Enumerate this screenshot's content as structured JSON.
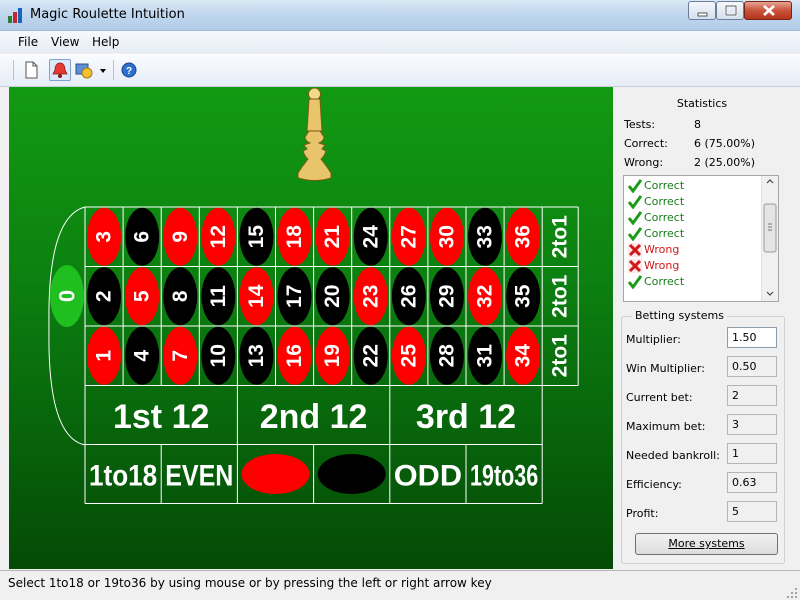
{
  "window": {
    "title": "Magic Roulette Intuition"
  },
  "menu": {
    "file": "File",
    "view": "View",
    "help": "Help"
  },
  "roulette": {
    "top_row": [
      "3",
      "6",
      "9",
      "12",
      "15",
      "18",
      "21",
      "24",
      "27",
      "30",
      "33",
      "36"
    ],
    "middle_row": [
      "2",
      "5",
      "8",
      "11",
      "14",
      "17",
      "20",
      "23",
      "26",
      "29",
      "32",
      "35"
    ],
    "bottom_row": [
      "1",
      "4",
      "7",
      "10",
      "13",
      "16",
      "19",
      "22",
      "25",
      "28",
      "31",
      "34"
    ],
    "top_colors": [
      "red",
      "black",
      "red",
      "red",
      "black",
      "red",
      "red",
      "black",
      "red",
      "red",
      "black",
      "red"
    ],
    "middle_colors": [
      "black",
      "red",
      "black",
      "black",
      "red",
      "black",
      "black",
      "red",
      "black",
      "black",
      "red",
      "black"
    ],
    "bottom_colors": [
      "red",
      "black",
      "red",
      "black",
      "black",
      "red",
      "red",
      "black",
      "red",
      "black",
      "black",
      "red"
    ],
    "zero": "0",
    "column_bets": [
      "2to1",
      "2to1",
      "2to1"
    ],
    "dozens": [
      "1st 12",
      "2nd 12",
      "3rd 12"
    ],
    "low": "1to18",
    "even": "EVEN",
    "odd": "ODD",
    "high": "19to36",
    "colors": {
      "red": "#ff0000",
      "black": "#000000",
      "green": "#0a8a0a",
      "zero": "#1fbf1f",
      "line": "#ffffff"
    }
  },
  "stats": {
    "title": "Statistics",
    "tests_label": "Tests:",
    "tests_value": "8",
    "correct_label": "Correct:",
    "correct_value": "6 (75.00%)",
    "wrong_label": "Wrong:",
    "wrong_value": "2 (25.00%)"
  },
  "results": [
    {
      "label": "Correct",
      "status": "correct"
    },
    {
      "label": "Correct",
      "status": "correct"
    },
    {
      "label": "Correct",
      "status": "correct"
    },
    {
      "label": "Correct",
      "status": "correct"
    },
    {
      "label": "Wrong",
      "status": "wrong"
    },
    {
      "label": "Wrong",
      "status": "wrong"
    },
    {
      "label": "Correct",
      "status": "correct"
    }
  ],
  "betting": {
    "title": "Betting systems",
    "multiplier_label": "Multiplier:",
    "multiplier_value": "1.50",
    "win_multiplier_label": "Win Multiplier:",
    "win_multiplier_value": "0.50",
    "current_bet_label": "Current bet:",
    "current_bet_value": "2",
    "maximum_bet_label": "Maximum bet:",
    "maximum_bet_value": "3",
    "needed_bankroll_label": "Needed bankroll:",
    "needed_bankroll_value": "1",
    "efficiency_label": "Efficiency:",
    "efficiency_value": "0.63",
    "profit_label": "Profit:",
    "profit_value": "5",
    "more_button": "More systems"
  },
  "status": {
    "text": "Select 1to18 or 19to36 by using mouse or by pressing the left or right arrow key"
  }
}
